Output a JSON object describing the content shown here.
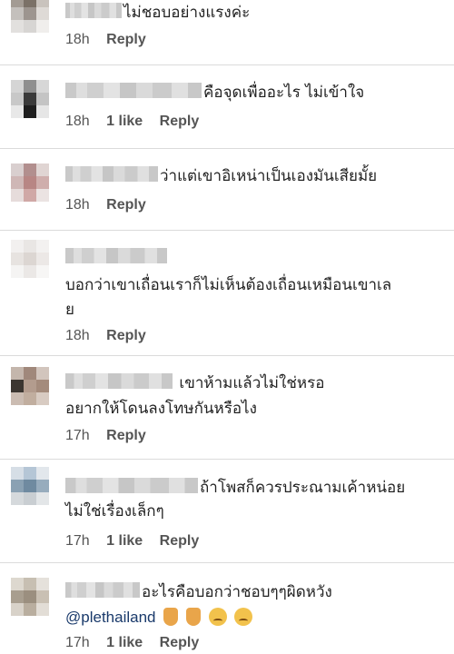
{
  "comments": [
    {
      "text": "ไม่ชอบอย่างแรงค่ะ",
      "name_blur_width": 62,
      "time": "18h",
      "likes": "",
      "reply": "Reply",
      "avatar": [
        "#a39b93",
        "#7b7167",
        "#c9c3bd",
        "#c4c0bc",
        "#9d958f",
        "#dedad6",
        "#e2e0de",
        "#d7d5d3",
        "#f0eeec"
      ]
    },
    {
      "text": "คือจุดเพื่ออะไร ไม่เข้าใจ",
      "name_blur_width": 150,
      "time": "18h",
      "likes": "1 like",
      "reply": "Reply",
      "avatar": [
        "#d5d5d5",
        "#8f8f8f",
        "#d7d7d7",
        "#c8c8c8",
        "#3b3b3b",
        "#c4c4c4",
        "#e8e8e8",
        "#1e1e1e",
        "#e6e6e6"
      ]
    },
    {
      "text": "ว่าแต่เขาอิเหน่าเป็นเองมันเสียมั้ย",
      "name_blur_width": 102,
      "time": "18h",
      "likes": "",
      "reply": "Reply",
      "avatar": [
        "#d9cfcf",
        "#b28f8e",
        "#e0d5d3",
        "#cfb7b6",
        "#b88684",
        "#cfaeac",
        "#e6dcdb",
        "#d0a8a6",
        "#ebe3e2"
      ]
    },
    {
      "lines": [
        "บอกว่าเขาเถื่อนเราก็ไม่เห็นต้องเถื่อนเหมือนเขาเล",
        "ย"
      ],
      "name_blur_width": 112,
      "time": "18h",
      "likes": "",
      "reply": "Reply",
      "avatar": [
        "#f2f0ef",
        "#e9e6e4",
        "#f3f1f0",
        "#e7e3e0",
        "#dcd6d2",
        "#ece8e6",
        "#f5f4f3",
        "#ebe8e6",
        "#f7f6f5"
      ]
    },
    {
      "lines": [
        "เขาห้ามแล้วไม่ใช่หรอ",
        "อยากให้โดนลงโทษกันหรือไง"
      ],
      "name_blur_width": 118,
      "time": "17h",
      "likes": "",
      "reply": "Reply",
      "avatar": [
        "#c4b6ac",
        "#a0887b",
        "#d2c5bd",
        "#3c3631",
        "#b39c8e",
        "#a48b7c",
        "#cbbcb2",
        "#c1ae9f",
        "#d8cbc2"
      ]
    },
    {
      "lines": [
        "ถ้าโพสก็ควรประณามเค้าหน่อย",
        "ไม่ใช่เรื่องเล็กๆ"
      ],
      "name_blur_width": 146,
      "time": "17h",
      "likes": "1 like",
      "reply": "Reply",
      "avatar": [
        "#d6dee6",
        "#b5c6d6",
        "#e2e7ec",
        "#8aa1b3",
        "#6f8aa0",
        "#97acbd",
        "#d5d9dc",
        "#c9ced2",
        "#e3e6e8"
      ]
    },
    {
      "text": "อะไรคือบอกว่าชอบๆๆผิดหวัง",
      "mention": "@plethailand",
      "emojis": [
        "thumb-down",
        "thumb-down",
        "pouting-face",
        "pouting-face"
      ],
      "name_blur_width": 82,
      "time": "17h",
      "likes": "1 like",
      "reply": "Reply",
      "avatar": [
        "#ddd8cf",
        "#c7bfb2",
        "#e5e1db",
        "#a89e8f",
        "#9b8f7f",
        "#c9c0b3",
        "#d8d2c9",
        "#b9ae9f",
        "#e2ddd6"
      ]
    }
  ]
}
